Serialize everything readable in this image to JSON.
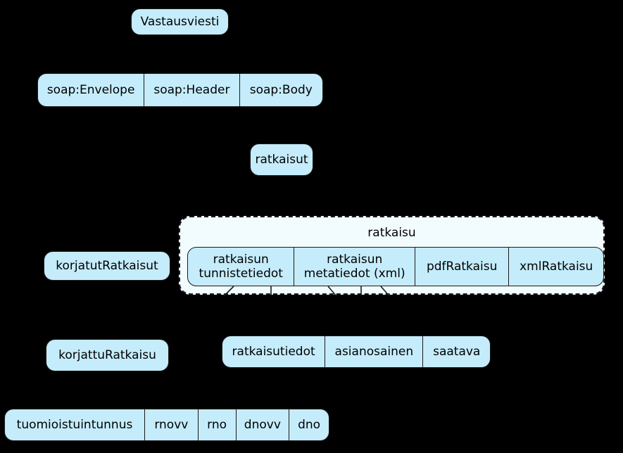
{
  "diagram": {
    "title": "Vastausviesti",
    "background_color": "#000000",
    "node_fill_color": "#c5ecfb",
    "node_border_color": "#1a1a1a",
    "group_fill_color": "#f2fbfe"
  },
  "root": {
    "label": "Vastausviesti"
  },
  "soap_row": {
    "cells": [
      {
        "label": "soap:Envelope"
      },
      {
        "label": "soap:Header"
      },
      {
        "label": "soap:Body"
      }
    ]
  },
  "ratkaisut": {
    "label": "ratkaisut"
  },
  "korjatut_ratkaisut": {
    "label": "korjatutRatkaisut"
  },
  "ratkaisu_group": {
    "title": "ratkaisu",
    "cells": [
      {
        "line1": "ratkaisun",
        "line2": "tunnistetiedot"
      },
      {
        "line1": "ratkaisun",
        "line2": "metatiedot (xml)"
      },
      {
        "line1": "pdfRatkaisu",
        "line2": ""
      },
      {
        "line1": "xmlRatkaisu",
        "line2": ""
      }
    ]
  },
  "korjattu_ratkaisu": {
    "label": "korjattuRatkaisu"
  },
  "ratkaisutiedot_row": {
    "cells": [
      {
        "label": "ratkaisutiedot"
      },
      {
        "label": "asianosainen"
      },
      {
        "label": "saatava"
      }
    ]
  },
  "tunniste_row": {
    "cells": [
      {
        "label": "tuomioistuintunnus"
      },
      {
        "label": "rnovv"
      },
      {
        "label": "rno"
      },
      {
        "label": "dnovv"
      },
      {
        "label": "dno"
      }
    ]
  }
}
